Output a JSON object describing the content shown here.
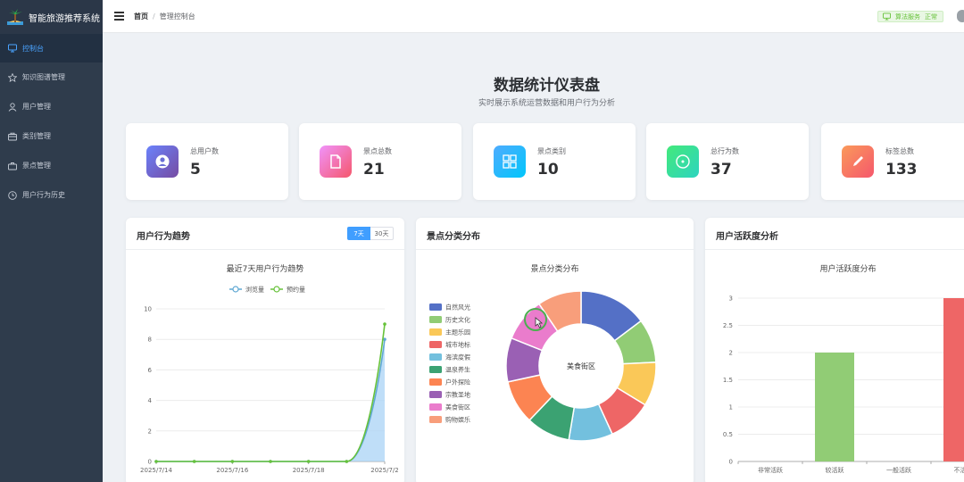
{
  "app": {
    "title": "智能旅游推荐系统"
  },
  "sidebar": {
    "items": [
      {
        "label": "控制台",
        "icon": "monitor-icon",
        "active": true
      },
      {
        "label": "知识图谱管理",
        "icon": "star-icon",
        "active": false
      },
      {
        "label": "用户管理",
        "icon": "user-icon",
        "active": false
      },
      {
        "label": "类别管理",
        "icon": "folder-icon",
        "active": false
      },
      {
        "label": "景点管理",
        "icon": "suitcase-icon",
        "active": false
      },
      {
        "label": "用户行为历史",
        "icon": "clock-icon",
        "active": false
      }
    ]
  },
  "header": {
    "breadcrumb": {
      "home": "首页",
      "separator": "/",
      "current": "管理控制台"
    },
    "status": {
      "label": "算法服务",
      "value": "正常"
    }
  },
  "page": {
    "title": "数据统计仪表盘",
    "subtitle": "实时展示系统运营数据和用户行为分析"
  },
  "stats": [
    {
      "label": "总用户数",
      "value": "5",
      "icon": "user-circle-icon",
      "color_from": "#6a82fb",
      "color_to": "#764ba2"
    },
    {
      "label": "景点总数",
      "value": "21",
      "icon": "document-icon",
      "color_from": "#f093fb",
      "color_to": "#f5576c"
    },
    {
      "label": "景点类别",
      "value": "10",
      "icon": "grid-icon",
      "color_from": "#4facfe",
      "color_to": "#00c6fb"
    },
    {
      "label": "总行为数",
      "value": "37",
      "icon": "target-icon",
      "color_from": "#43e97b",
      "color_to": "#38f9d7"
    },
    {
      "label": "标签总数",
      "value": "133",
      "icon": "pen-icon",
      "color_from": "#fa9a5a",
      "color_to": "#f5576c"
    }
  ],
  "panels": {
    "trend": {
      "title": "用户行为趋势",
      "range_options": [
        "7天",
        "30天"
      ],
      "active_range": "7天"
    },
    "category": {
      "title": "景点分类分布"
    },
    "activity": {
      "title": "用户活跃度分析"
    }
  },
  "chart_data": [
    {
      "type": "line",
      "title": "最近7天用户行为趋势",
      "x": [
        "2025/7/14",
        "2025/7/15",
        "2025/7/16",
        "2025/7/17",
        "2025/7/18",
        "2025/7/19",
        "2025/7/2"
      ],
      "x_tick_labels": [
        "2025/7/14",
        "2025/7/16",
        "2025/7/18",
        "2025/7/2"
      ],
      "series": [
        {
          "name": "浏览量",
          "values": [
            0,
            0,
            0,
            0,
            0,
            0,
            8
          ],
          "color": "#5fa8d3"
        },
        {
          "name": "预约量",
          "values": [
            0,
            0,
            0,
            0,
            0,
            0,
            9
          ],
          "color": "#67c23a"
        }
      ],
      "ylim": [
        0,
        10
      ],
      "y_ticks": [
        0,
        2,
        4,
        6,
        8,
        10
      ],
      "legend": "top-center"
    },
    {
      "type": "pie",
      "title": "景点分类分布",
      "center_label": "美食街区",
      "labels": [
        "自然风光",
        "历史文化",
        "主题乐园",
        "城市地标",
        "海滨度假",
        "温泉养生",
        "户外探险",
        "宗教圣地",
        "美食街区",
        "购物娱乐"
      ],
      "values": [
        14,
        9,
        9,
        9,
        9,
        9,
        9,
        9,
        9,
        9
      ],
      "colors": [
        "#5470c6",
        "#91cc75",
        "#fac858",
        "#ee6666",
        "#73c0de",
        "#3ba272",
        "#fc8452",
        "#9a60b4",
        "#ea7ccc",
        "#f89e7b"
      ],
      "legend": "left"
    },
    {
      "type": "bar",
      "title": "用户活跃度分布",
      "categories": [
        "非常活跃",
        "较活跃",
        "一般活跃",
        "不活跃"
      ],
      "values": [
        0,
        2,
        0,
        3
      ],
      "colors": [
        "#5470c6",
        "#91cc75",
        "#fac858",
        "#ee6666"
      ],
      "ylim": [
        0,
        3
      ],
      "y_ticks": [
        0,
        0.5,
        1,
        1.5,
        2,
        2.5,
        3
      ]
    }
  ]
}
